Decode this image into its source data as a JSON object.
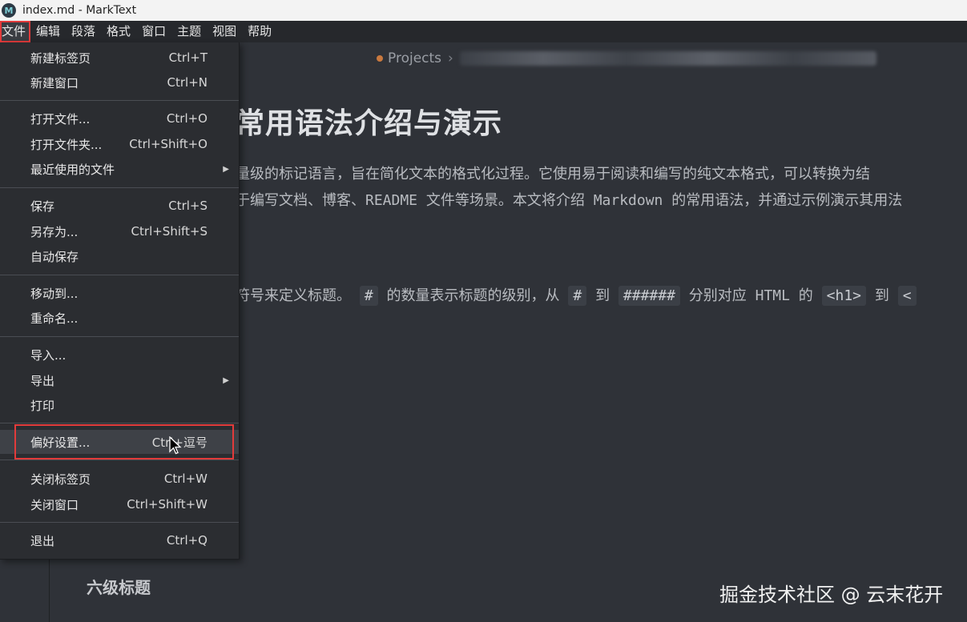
{
  "window": {
    "title": "index.md - MarkText",
    "logo_icon": "marktext-logo-icon"
  },
  "menubar": [
    "文件",
    "编辑",
    "段落",
    "格式",
    "窗口",
    "主题",
    "视图",
    "帮助"
  ],
  "file_menu": {
    "items": [
      {
        "label": "新建标签页",
        "shortcut": "Ctrl+T"
      },
      {
        "label": "新建窗口",
        "shortcut": "Ctrl+N"
      },
      {
        "label": "打开文件...",
        "shortcut": "Ctrl+O"
      },
      {
        "label": "打开文件夹...",
        "shortcut": "Ctrl+Shift+O"
      },
      {
        "label": "最近使用的文件",
        "submenu": true
      },
      {
        "label": "保存",
        "shortcut": "Ctrl+S"
      },
      {
        "label": "另存为...",
        "shortcut": "Ctrl+Shift+S"
      },
      {
        "label": "自动保存"
      },
      {
        "label": "移动到..."
      },
      {
        "label": "重命名..."
      },
      {
        "label": "导入..."
      },
      {
        "label": "导出",
        "submenu": true
      },
      {
        "label": "打印"
      },
      {
        "label": "偏好设置...",
        "shortcut": "Ctrl+逗号",
        "highlighted": true
      },
      {
        "label": "关闭标签页",
        "shortcut": "Ctrl+W"
      },
      {
        "label": "关闭窗口",
        "shortcut": "Ctrl+Shift+W"
      },
      {
        "label": "退出",
        "shortcut": "Ctrl+Q"
      }
    ]
  },
  "editor": {
    "breadcrumb": "Projects",
    "title": "常用语法介绍与演示",
    "para1_line1": "量级的标记语言，旨在简化文本的格式化过程。它使用易于阅读和编写的纯文本格式，可以转换为结",
    "para1_line2": "于编写文档、博客、README 文件等场景。本文将介绍 Markdown 的常用语法，并通过示例演示其用法",
    "para2": {
      "t1": "符号来定义标题。",
      "c1": "#",
      "t2": "的数量表示标题的级别，从",
      "c2": "#",
      "t3": "到",
      "c3": "######",
      "t4": "分别对应 HTML 的",
      "c4": "<h1>",
      "t5": "到",
      "c5": "<"
    },
    "h6": "六级标题"
  },
  "watermark": "掘金技术社区 @ 云末花开",
  "colors": {
    "highlight_border": "#e23b3b",
    "menu_bg": "#2b2d31",
    "editor_bg": "#2f3238"
  }
}
